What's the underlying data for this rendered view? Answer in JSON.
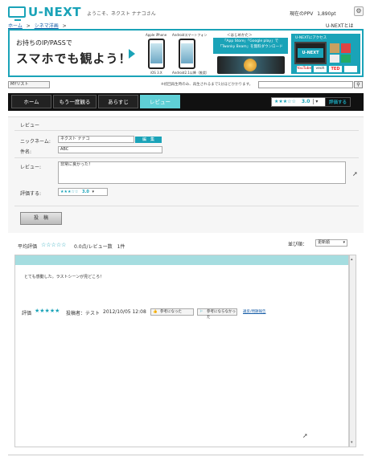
{
  "header": {
    "logo_text": "U-NEXT",
    "welcome": "ようこそ、ネクスト ナナコさん",
    "ppv_label": "現在のPPV",
    "ppv_value": "1,890pt",
    "settings_icon": "gear-icon"
  },
  "breadcrumb": {
    "home": "ホーム",
    "sep1": ">",
    "current": "シネマ洋画",
    "sep2": ">"
  },
  "about_link": "U-NEXTとは",
  "banner": {
    "line1": "お持ちのIP/PASSで",
    "line2": "スマホでも観よう！",
    "iphone_label": "Apple iPhone",
    "android_label": "Androidスマートフォン",
    "ios_ver": "iOS 3.X",
    "android_ver": "Android2.1以降（推奨）",
    "dl_title": "＜はじめかた＞",
    "dl_text": "「App Store」「Google play」で「Twonky Beam」を無料ダウンロード",
    "tv_title": "U-NEXTにアクセス",
    "tv_logo": "U-NEXT",
    "tv_icons": [
      "YouTube",
      "veoh",
      "TED"
    ]
  },
  "mylist": "MYリスト",
  "search_note": "※初回再生時のみ、再生されるまで1分ほどかかります。",
  "search": {
    "placeholder": "",
    "icon": "search-icon"
  },
  "nav": {
    "tabs": [
      "ホーム",
      "もう一度観る",
      "あらすじ",
      "レビュー"
    ],
    "active": "レビュー"
  },
  "top_rating": {
    "stars": "★★★☆☆",
    "value": "3.0",
    "button": "評価する"
  },
  "form": {
    "section_title": "レビュー",
    "nickname_label": "ニックネーム:",
    "nickname_value": "ネクスト ナナコ",
    "edit_button": "編　集",
    "subject_label": "件名:",
    "subject_value": "ABC",
    "review_label": "レビュー:",
    "review_value": "非常に良かった！",
    "rating_label": "評価する:",
    "rating_stars": "★★★☆☆",
    "rating_value": "3.0",
    "submit": "投　稿"
  },
  "summary": {
    "label": "平均評価",
    "stars": "☆☆☆☆☆",
    "text": "0.0点/レビュー数　1件",
    "sort_label": "並び順：",
    "sort_value": "更新順"
  },
  "review": {
    "body": "とても感動した。ラストシーンが見どころ！",
    "rating_label": "評価",
    "stars": "★★★★★",
    "poster": "投稿者：テスト",
    "date": "2012/10/05 12:08",
    "helpful": "参考になった",
    "not_helpful": "参考にならなかった",
    "report": "違反/問題報告"
  },
  "colors": {
    "accent": "#1aa3b8",
    "nav_bg": "#111111",
    "active_tab": "#5fcfd6",
    "review_header": "#a5dde0"
  }
}
